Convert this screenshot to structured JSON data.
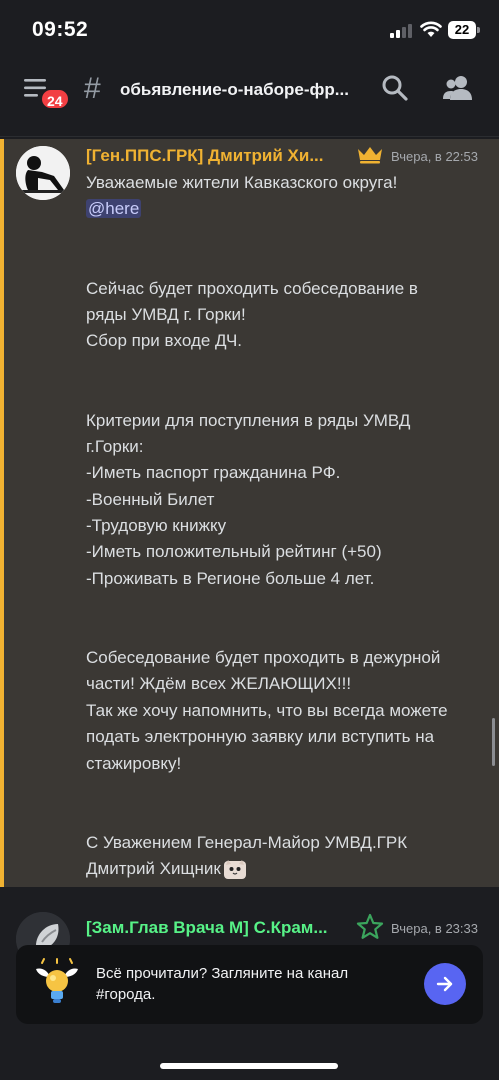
{
  "status_bar": {
    "time": "09:52",
    "battery": "22"
  },
  "header": {
    "unread_count": "24",
    "channel_hash": "#",
    "channel_name": "обьявление-о-наборе-фр..."
  },
  "messages": [
    {
      "author": "[Ген.ППС.ГРК] Дмитрий Хи...",
      "author_color": "#f0b232",
      "role_icon": "crown-icon",
      "time": "Вчера, в 22:53",
      "lines": [
        "Уважаемые жители Кавказского округа!",
        "",
        "",
        "",
        "Сейчас будет проходить собеседование в",
        "ряды УМВД г. Горки!",
        "Сбор при входе ДЧ.",
        "",
        "",
        "Критерии для поступления в ряды УМВД",
        "г.Горки:",
        "-Иметь паспорт гражданина РФ.",
        "-Военный Билет",
        "-Трудовую книжку",
        "-Иметь положительный рейтинг (+50)",
        "-Проживать в Регионе больше 4 лет.",
        "",
        "",
        "Собеседование будет проходить в дежурной",
        "части! Ждём всех ЖЕЛАЮЩИХ!!!",
        "Так же хочу напомнить, что вы всегда можете",
        "подать электронную заявку или вступить на",
        "стажировку!",
        "",
        "",
        "С Уважением Генерал-Майор УМВД.ГРК",
        "Дмитрий Хищник"
      ],
      "mention": "@here"
    },
    {
      "author": "[Зам.Глав Врача М] С.Крам...",
      "author_color": "#57f287",
      "role_icon": "star-icon",
      "time": "Вчера, в 23:33"
    }
  ],
  "notice": {
    "line1": "Всё прочитали? Загляните на канал",
    "line2": "#города."
  },
  "colors": {
    "highlight_bg": "#3b3834",
    "highlight_border": "#f0b232",
    "accent": "#5865f2",
    "badge": "#f23f43",
    "mention_bg": "#3e4270"
  }
}
